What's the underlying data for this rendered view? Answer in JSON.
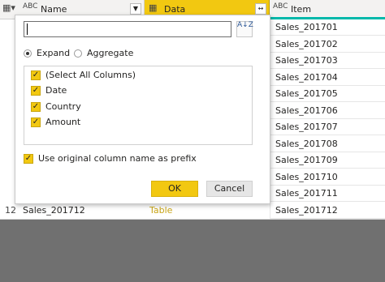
{
  "columns": {
    "name": {
      "type_icon": "ABC",
      "label": "Name"
    },
    "data": {
      "label": "Data",
      "expand_icon": "↔"
    },
    "item": {
      "type_icon": "ABC",
      "label": "Item"
    }
  },
  "item_values": [
    "Sales_201701",
    "Sales_201702",
    "Sales_201703",
    "Sales_201704",
    "Sales_201705",
    "Sales_201706",
    "Sales_201707",
    "Sales_201708",
    "Sales_201709",
    "Sales_201710",
    "Sales_201711",
    "Sales_201712"
  ],
  "last_row": {
    "index": "12",
    "name": "Sales_201712",
    "data": "Table",
    "item": "Sales_201712"
  },
  "dialog": {
    "search_value": "",
    "sort_icon": "A↓Z",
    "radio_expand": "Expand",
    "radio_aggregate": "Aggregate",
    "columns_list": [
      "(Select All Columns)",
      "Date",
      "Country",
      "Amount"
    ],
    "prefix_label": "Use original column name as prefix",
    "ok_label": "OK",
    "cancel_label": "Cancel"
  },
  "colors": {
    "accent": "#f2c811",
    "item_underline": "#01b8aa",
    "table_text": "#c8a415"
  }
}
